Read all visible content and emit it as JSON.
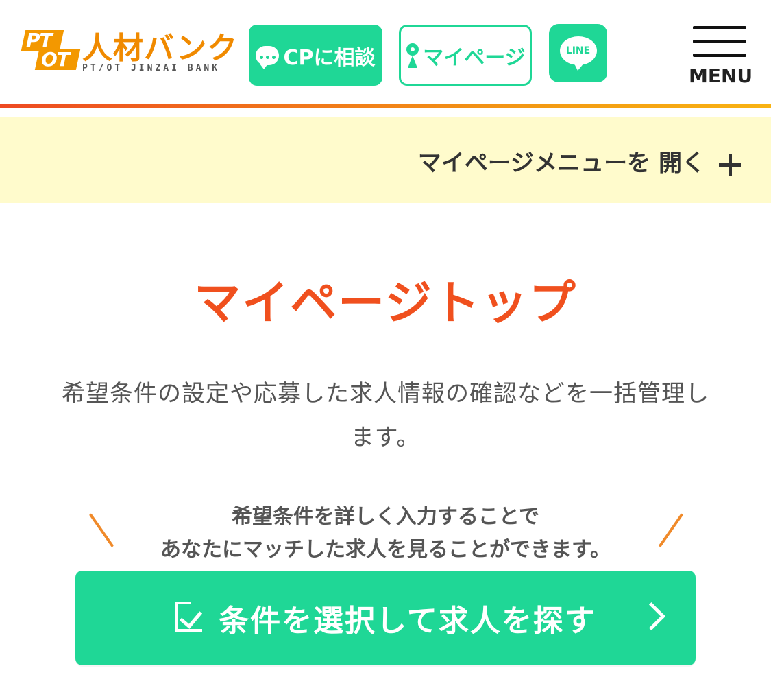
{
  "header": {
    "logo": {
      "badge_top": "PT",
      "badge_bottom": "OT",
      "name": "人材バンク",
      "sub": "PT/OT JINZAI BANK"
    },
    "cp_button_label": "CPに相談",
    "mypage_button_label": "マイページ",
    "line_label": "LINE",
    "menu_label": "MENU"
  },
  "mypage_menu": {
    "label": "マイページメニューを 開く"
  },
  "main": {
    "title": "マイページトップ",
    "description": "希望条件の設定や応募した求人情報の確認などを一括管理します。",
    "callout_line1": "希望条件を詳しく入力することで",
    "callout_line2": "あなたにマッチした求人を見ることができます。",
    "cta_label": "条件を選択して求人を探す"
  },
  "colors": {
    "accent_green": "#1fd796",
    "title_orange": "#f0501e",
    "logo_orange": "#f08a00",
    "menu_bar_bg": "#fffbcc"
  }
}
